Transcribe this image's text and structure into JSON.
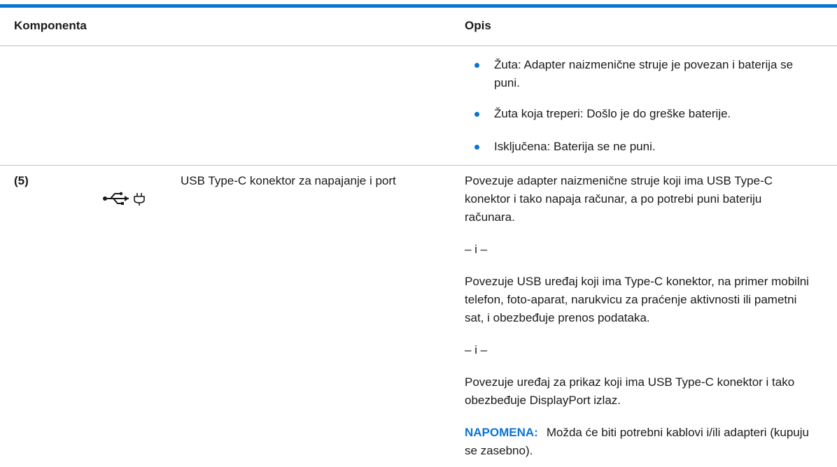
{
  "table": {
    "headers": {
      "component": "Komponenta",
      "description": "Opis"
    },
    "row_battery": {
      "bullets": [
        "Žuta: Adapter naizmenične struje je povezan i baterija se puni.",
        "Žuta koja treperi: Došlo je do greške baterije.",
        "Isključena: Baterija se ne puni."
      ]
    },
    "row_usb": {
      "number": "(5)",
      "icon": "usb-power-icon",
      "component": "USB Type-C konektor za napajanje i port",
      "paragraphs": [
        "Povezuje adapter naizmenične struje koji ima USB Type-C konektor i tako napaja računar, a po potrebi puni bateriju računara.",
        "– i –",
        "Povezuje USB uređaj koji ima Type-C konektor, na primer mobilni telefon, foto-aparat, narukvicu za praćenje aktivnosti ili pametni sat, i obezbeđuje prenos podataka.",
        "– i –",
        "Povezuje uređaj za prikaz koji ima USB Type-C konektor i tako obezbeđuje DisplayPort izlaz."
      ],
      "note_label": "NAPOMENA:",
      "note_text": "Možda će biti potrebni kablovi i/ili adapteri (kupuju se zasebno)."
    }
  },
  "colors": {
    "accent": "#0a74d4",
    "rule": "#bfbfbf",
    "text": "#1a1a1a"
  }
}
